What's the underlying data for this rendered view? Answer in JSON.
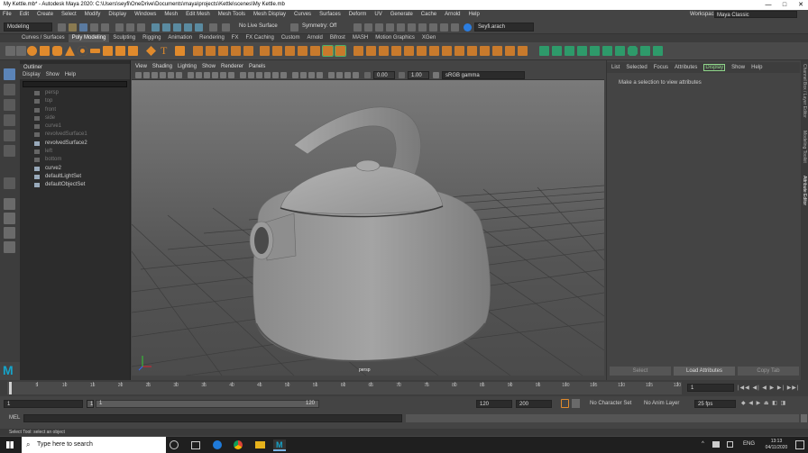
{
  "window": {
    "title": "My Kettle.mb* - Autodesk Maya 2020: C:\\Users\\seyfi\\OneDrive\\Documents\\maya\\projects\\Kettle\\scenes\\My Kettle.mb",
    "minimize": "—",
    "maximize": "□",
    "close": "✕"
  },
  "menus": [
    "File",
    "Edit",
    "Create",
    "Select",
    "Modify",
    "Display",
    "Windows",
    "Mesh",
    "Edit Mesh",
    "Mesh Tools",
    "Mesh Display",
    "Curves",
    "Surfaces",
    "Deform",
    "UV",
    "Generate",
    "Cache",
    "Arnold",
    "Help"
  ],
  "workspace": {
    "label": "Workspace :",
    "value": "Maya Classic"
  },
  "status": {
    "mode": "Modeling",
    "live_surface": "No Live Surface",
    "symmetry": "Symmetry: Off",
    "user": "Seyfi.arach"
  },
  "shelf_tabs": [
    "Curves / Surfaces",
    "Poly Modeling",
    "Sculpting",
    "Rigging",
    "Animation",
    "Rendering",
    "FX",
    "FX Caching",
    "Custom",
    "Arnold",
    "Bifrost",
    "MASH",
    "Motion Graphics",
    "XGen"
  ],
  "active_shelf_tab": "Poly Modeling",
  "outliner": {
    "title": "Outliner",
    "menu": [
      "Display",
      "Show",
      "Help"
    ],
    "items": [
      {
        "label": "persp",
        "dim": true
      },
      {
        "label": "top",
        "dim": true
      },
      {
        "label": "front",
        "dim": true
      },
      {
        "label": "side",
        "dim": true
      },
      {
        "label": "curve1",
        "dim": true
      },
      {
        "label": "revolvedSurface1",
        "dim": true
      },
      {
        "label": "revolvedSurface2",
        "dim": false
      },
      {
        "label": "left",
        "dim": true
      },
      {
        "label": "bottom",
        "dim": true
      },
      {
        "label": "curve2",
        "dim": false
      },
      {
        "label": "defaultLightSet",
        "dim": false
      },
      {
        "label": "defaultObjectSet",
        "dim": false
      }
    ]
  },
  "viewport": {
    "menu": [
      "View",
      "Shading",
      "Lighting",
      "Show",
      "Renderer",
      "Panels"
    ],
    "exposure": "0.00",
    "gamma": "1.00",
    "color_space": "sRGB gamma",
    "camera_label": "persp"
  },
  "attribute_editor": {
    "menu": [
      "List",
      "Selected",
      "Focus",
      "Attributes",
      "Display",
      "Show",
      "Help"
    ],
    "active_menu": "Display",
    "message": "Make a selection to view attributes",
    "buttons": [
      "Select",
      "Load Attributes",
      "Copy Tab"
    ]
  },
  "side_tabs": [
    "Channel Box / Layer Editor",
    "Modeling Toolkit",
    "Attribute Editor"
  ],
  "timeline": {
    "ticks": [
      "5",
      "10",
      "15",
      "20",
      "25",
      "30",
      "35",
      "40",
      "45",
      "50",
      "55",
      "60",
      "65",
      "70",
      "75",
      "80",
      "85",
      "90",
      "95",
      "100",
      "105",
      "110",
      "115",
      "120"
    ],
    "current_frame": "1",
    "range_start": "1",
    "range_start2": "1",
    "range_inner_start": "1",
    "range_inner_end": "120",
    "range_end": "120",
    "anim_end": "200",
    "character_set": "No Character Set",
    "anim_layer": "No Anim Layer",
    "fps": "25 fps"
  },
  "command_line": {
    "label": "MEL"
  },
  "help_line": "Select Tool: select an object",
  "taskbar": {
    "search_placeholder": "Type here to search",
    "lang": "ENG",
    "time": "13:13",
    "date": "04/11/2020"
  }
}
